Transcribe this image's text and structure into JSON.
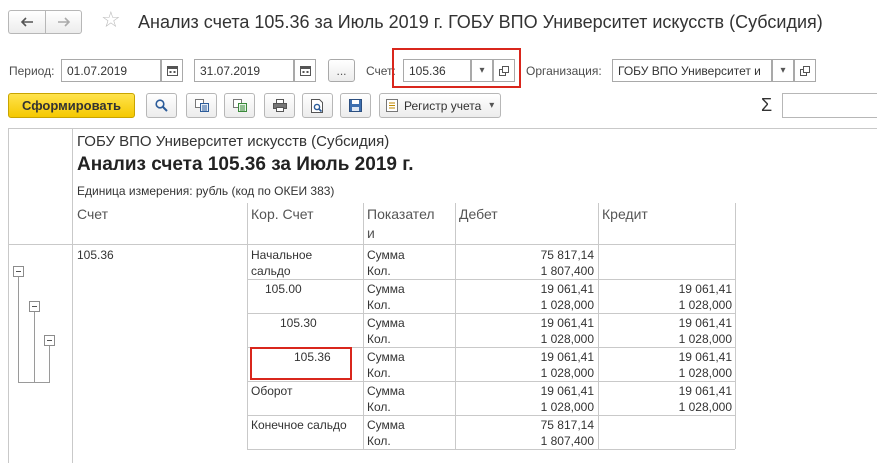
{
  "window": {
    "title": "Анализ счета 105.36 за Июль 2019 г. ГОБУ ВПО Университет искусств (Субсидия)"
  },
  "params": {
    "period_label": "Период:",
    "date_from": "01.07.2019",
    "date_to": "31.07.2019",
    "more_button": "...",
    "account_label": "Счет:",
    "account_value": "105.36",
    "org_label": "Организация:",
    "org_value": "ГОБУ ВПО Университет и"
  },
  "toolbar": {
    "generate_label": "Сформировать",
    "register_label": "Регистр учета",
    "sigma": "Σ"
  },
  "report": {
    "org_name": "ГОБУ ВПО Университет искусств (Субсидия)",
    "heading": "Анализ счета 105.36 за Июль 2019 г.",
    "unit_note": "Единица измерения: рубль (код по ОКЕИ 383)",
    "columns": {
      "account": "Счет",
      "corr": "Кор. Счет",
      "indicator_1": "Показател",
      "indicator_2": "и",
      "debit": "Дебет",
      "credit": "Кредит"
    },
    "account_value": "105.36",
    "groups": [
      {
        "corr_1": "Начальное",
        "corr_2": "сальдо",
        "sum_label": "Сумма",
        "qty_label": "Кол.",
        "debit_sum": "75 817,14",
        "debit_qty": "1 807,400",
        "credit_sum": "",
        "credit_qty": ""
      },
      {
        "corr_1": "105.00",
        "sum_label": "Сумма",
        "qty_label": "Кол.",
        "debit_sum": "19 061,41",
        "debit_qty": "1 028,000",
        "credit_sum": "19 061,41",
        "credit_qty": "1 028,000"
      },
      {
        "corr_1": "105.30",
        "sum_label": "Сумма",
        "qty_label": "Кол.",
        "debit_sum": "19 061,41",
        "debit_qty": "1 028,000",
        "credit_sum": "19 061,41",
        "credit_qty": "1 028,000"
      },
      {
        "corr_1": "105.36",
        "sum_label": "Сумма",
        "qty_label": "Кол.",
        "debit_sum": "19 061,41",
        "debit_qty": "1 028,000",
        "credit_sum": "19 061,41",
        "credit_qty": "1 028,000"
      },
      {
        "corr_1": "Оборот",
        "sum_label": "Сумма",
        "qty_label": "Кол.",
        "debit_sum": "19 061,41",
        "debit_qty": "1 028,000",
        "credit_sum": "19 061,41",
        "credit_qty": "1 028,000"
      },
      {
        "corr_1": "Конечное сальдо",
        "sum_label": "Сумма",
        "qty_label": "Кол.",
        "debit_sum": "75 817,14",
        "debit_qty": "1 807,400",
        "credit_sum": "",
        "credit_qty": ""
      }
    ]
  },
  "colors": {
    "highlight": "#d9261c",
    "primary_button": "#f5c800",
    "grid": "#c9c9c9"
  },
  "icons": [
    "back-arrow-icon",
    "forward-arrow-icon",
    "favorite-star-icon",
    "calendar-icon",
    "dropdown-icon",
    "open-icon",
    "search-icon",
    "copy-icon",
    "print-icon",
    "preview-icon",
    "save-icon",
    "register-icon",
    "collapse-icon"
  ]
}
